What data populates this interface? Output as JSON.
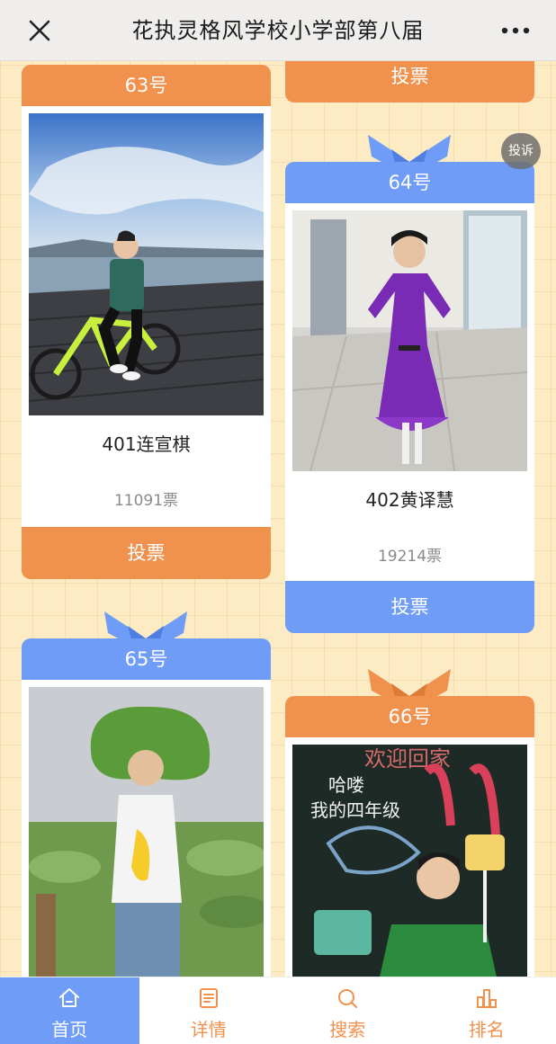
{
  "topbar": {
    "title": "花执灵格风学校小学部第八届"
  },
  "report_label": "投诉",
  "vote_label": "投票",
  "cards": [
    {
      "number": "63号",
      "name": "401连宣棋",
      "votes": "11091票",
      "color": "#f0914e"
    },
    {
      "number": "64号",
      "name": "402黄译慧",
      "votes": "19214票",
      "color": "#6f9cf7"
    },
    {
      "number": "65号",
      "color": "#6f9cf7"
    },
    {
      "number": "66号",
      "color": "#f0914e"
    }
  ],
  "photo_texts": {
    "chalkboard_line1": "哈喽",
    "chalkboard_line2": "我的四年级",
    "chalkboard_top": "欢迎回家"
  },
  "bottom_nav": [
    {
      "label": "首页",
      "icon": "home-icon",
      "active": true
    },
    {
      "label": "详情",
      "icon": "details-icon",
      "active": false
    },
    {
      "label": "搜索",
      "icon": "search-icon",
      "active": false
    },
    {
      "label": "排名",
      "icon": "ranking-icon",
      "active": false
    }
  ],
  "colors": {
    "orange": "#f0914e",
    "blue": "#6f9cf7",
    "background": "#fdebc3"
  }
}
